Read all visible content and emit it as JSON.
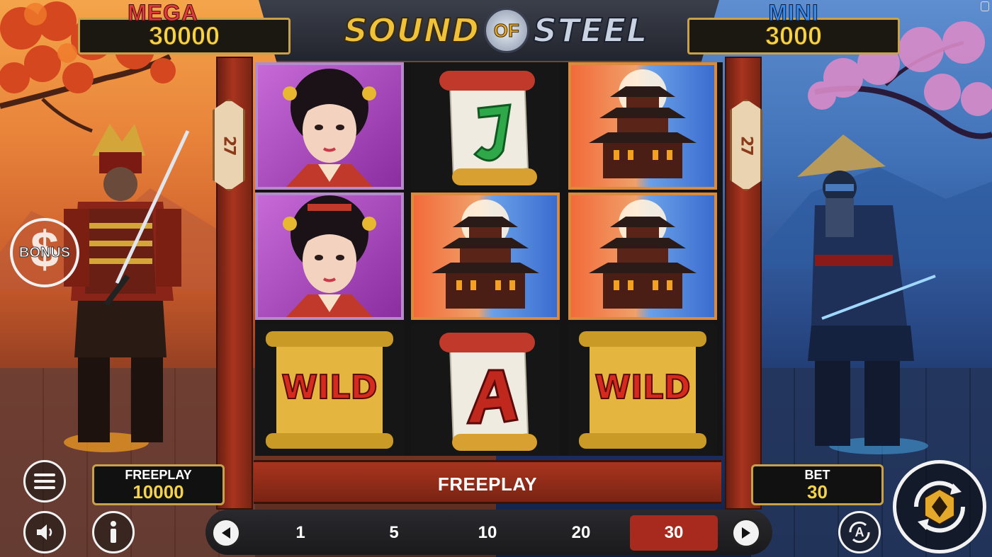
{
  "title": {
    "part1": "SOUND",
    "part2": "OF",
    "part3": "STEEL"
  },
  "jackpots": {
    "mega": {
      "label": "MEGA",
      "value": "30000"
    },
    "mini": {
      "label": "MINI",
      "value": "3000"
    }
  },
  "paylines": {
    "left": "27",
    "right": "27"
  },
  "reels": [
    [
      "geisha",
      "geisha",
      "wild"
    ],
    [
      "scroll-J",
      "temple",
      "scroll-A"
    ],
    [
      "temple",
      "temple",
      "wild"
    ]
  ],
  "symbols": {
    "wild_text": "WILD"
  },
  "bottom_bar": {
    "mode_text": "FREEPLAY"
  },
  "balance": {
    "label": "FREEPLAY",
    "value": "10000"
  },
  "bet": {
    "label": "BET",
    "value": "30"
  },
  "bet_options": [
    "1",
    "5",
    "10",
    "20",
    "30"
  ],
  "bet_selected": "30",
  "bonus_button": {
    "label": "BONUS"
  },
  "buttons": {
    "auto_label": "A",
    "menu_icon": "hamburger-icon",
    "sound_icon": "speaker-icon",
    "info_icon": "info-icon",
    "spin_icon": "spin-icon"
  },
  "colors": {
    "mega": "#e03a3a",
    "mini": "#3a8ae8",
    "value": "#f4d24b",
    "bet_active": "#a82a1e"
  }
}
